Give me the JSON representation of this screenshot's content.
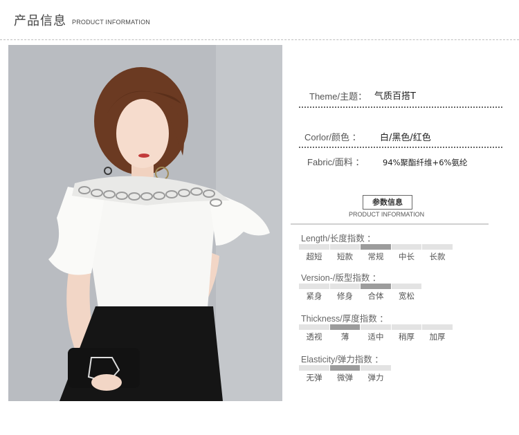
{
  "header": {
    "title_cn": "产品信息",
    "title_en": "PRODUCT INFORMATION"
  },
  "product": {
    "theme_label": "Theme/主题：",
    "theme_value": "气质百搭T",
    "color_label": "Corlor/颜色 ：",
    "color_value": "白/黑色/红色",
    "fabric_label": "Fabric/面料 ：",
    "fabric_value": "94%聚酯纤维+6%氨纶"
  },
  "params": {
    "badge": "参数信息",
    "badge_en": "PRODUCT INFORMATION"
  },
  "indices": [
    {
      "title": "Length/长度指数 ：",
      "options": [
        "超短",
        "短款",
        "常规",
        "中长",
        "长款"
      ],
      "selected": 2
    },
    {
      "title": "Version-/版型指数 ：",
      "options": [
        "紧身",
        "修身",
        "合体",
        "宽松"
      ],
      "selected": 2
    },
    {
      "title": "Thickness/厚度指数 ：",
      "options": [
        "透视",
        "薄",
        "适中",
        "稍厚",
        "加厚"
      ],
      "selected": 1
    },
    {
      "title": "Elasticity/弹力指数 ：",
      "options": [
        "无弹",
        "微弹",
        "弹力"
      ],
      "selected": 1
    }
  ],
  "colors": {
    "selected_bar": "#9c9c9c",
    "bar": "#e3e3e3",
    "photo_bg": "#b9bcc1"
  }
}
